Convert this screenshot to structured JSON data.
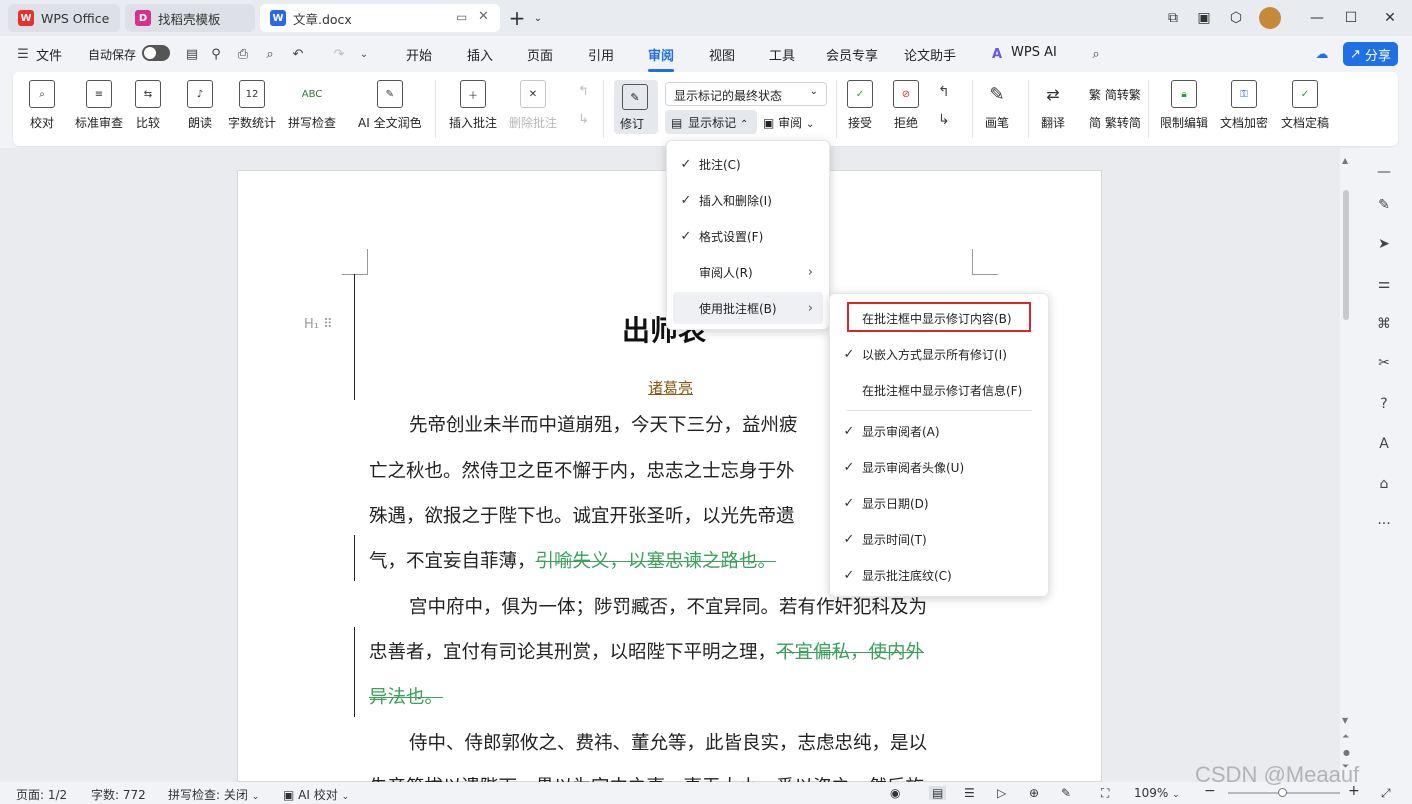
{
  "tabs": [
    {
      "label": "WPS Office",
      "icon": "wps-logo-icon",
      "color": "#e8302d"
    },
    {
      "label": "找稻壳模板",
      "icon": "docer-icon",
      "color": "#d6318c"
    },
    {
      "label": "文章.docx",
      "icon": "word-doc-icon",
      "color": "#2b68e8"
    }
  ],
  "menubar": {
    "file": "文件",
    "autosave": "自动保存",
    "items": [
      "开始",
      "插入",
      "页面",
      "引用",
      "审阅",
      "视图",
      "工具",
      "会员专享",
      "论文助手"
    ],
    "active": "审阅",
    "wps_ai": "WPS AI",
    "share": "分享"
  },
  "ribbon": {
    "proofread": "校对",
    "standard_review": "标准审查",
    "compare": "比较",
    "read_aloud": "朗读",
    "word_count": "字数统计",
    "spell_check": "拼写检查",
    "ai_polish": "AI 全文润色",
    "insert_comment": "插入批注",
    "delete_comment": "删除批注",
    "track_changes": "修订",
    "display_state": "显示标记的最终状态",
    "show_markup": "显示标记",
    "review_pane": "审阅",
    "accept": "接受",
    "reject": "拒绝",
    "pen": "画笔",
    "translate": "翻译",
    "to_traditional": "简转繁",
    "to_simplified": "繁转简",
    "restrict_edit": "限制编辑",
    "doc_encrypt": "文档加密",
    "doc_finalize": "文档定稿",
    "abc_label": "ABC",
    "count_icon_label": "12"
  },
  "document": {
    "title": "出师表",
    "author": "诸葛亮",
    "lines": [
      {
        "text": "先帝创业未半而中道崩殂，今天下三分，益州疲",
        "del": ""
      },
      {
        "text": "亡之秋也。然侍卫之臣不懈于内，忠志之士忘身于外",
        "del": ""
      },
      {
        "text": "殊遇，欲报之于陛下也。诚宜开张圣听，以光先帝遗",
        "del": ""
      },
      {
        "text": "气，不宜妄自菲薄，",
        "del": "引喻失义，以塞忠谏之路也。"
      },
      {
        "text": "宫中府中，俱为一体；陟罚臧否，不宜异同。若有作奸犯科及为",
        "del": ""
      },
      {
        "text": "忠善者，宜付有司论其刑赏，以昭陛下平明之理，",
        "del": "不宜偏私，使内外"
      },
      {
        "text": "",
        "del": "异法也。"
      },
      {
        "text": "侍中、侍郎郭攸之、费祎、董允等，此皆良实，志虑忠纯，是以",
        "del": ""
      },
      {
        "text": "先帝简拔以遗陛下。愚以为宫中之事，事无大小，悉以咨之，然后施",
        "del": ""
      }
    ]
  },
  "markup_menu": {
    "items": [
      {
        "label": "批注(C)",
        "checked": true,
        "submenu": false
      },
      {
        "label": "插入和删除(I)",
        "checked": true,
        "submenu": false
      },
      {
        "label": "格式设置(F)",
        "checked": true,
        "submenu": false
      },
      {
        "label": "审阅人(R)",
        "checked": false,
        "submenu": true
      },
      {
        "label": "使用批注框(B)",
        "checked": false,
        "submenu": true
      }
    ]
  },
  "balloon_menu": {
    "items": [
      {
        "label": "在批注框中显示修订内容(B)",
        "checked": false
      },
      {
        "label": "以嵌入方式显示所有修订(I)",
        "checked": true
      },
      {
        "label": "在批注框中显示修订者信息(F)",
        "checked": false
      }
    ],
    "items2": [
      {
        "label": "显示审阅者(A)",
        "checked": true
      },
      {
        "label": "显示审阅者头像(U)",
        "checked": true
      },
      {
        "label": "显示日期(D)",
        "checked": true
      },
      {
        "label": "显示时间(T)",
        "checked": true
      },
      {
        "label": "显示批注底纹(C)",
        "checked": true
      }
    ]
  },
  "statusbar": {
    "page": "页面: 1/2",
    "words": "字数: 772",
    "spell": "拼写检查: 关闭",
    "ai_proof": "AI 校对",
    "zoom": "109%"
  },
  "watermark": "CSDN @Meaauf",
  "colors": {
    "accent": "#1f6fe5",
    "deleted_text": "#3aa05a",
    "highlight_box": "#d9252b"
  }
}
